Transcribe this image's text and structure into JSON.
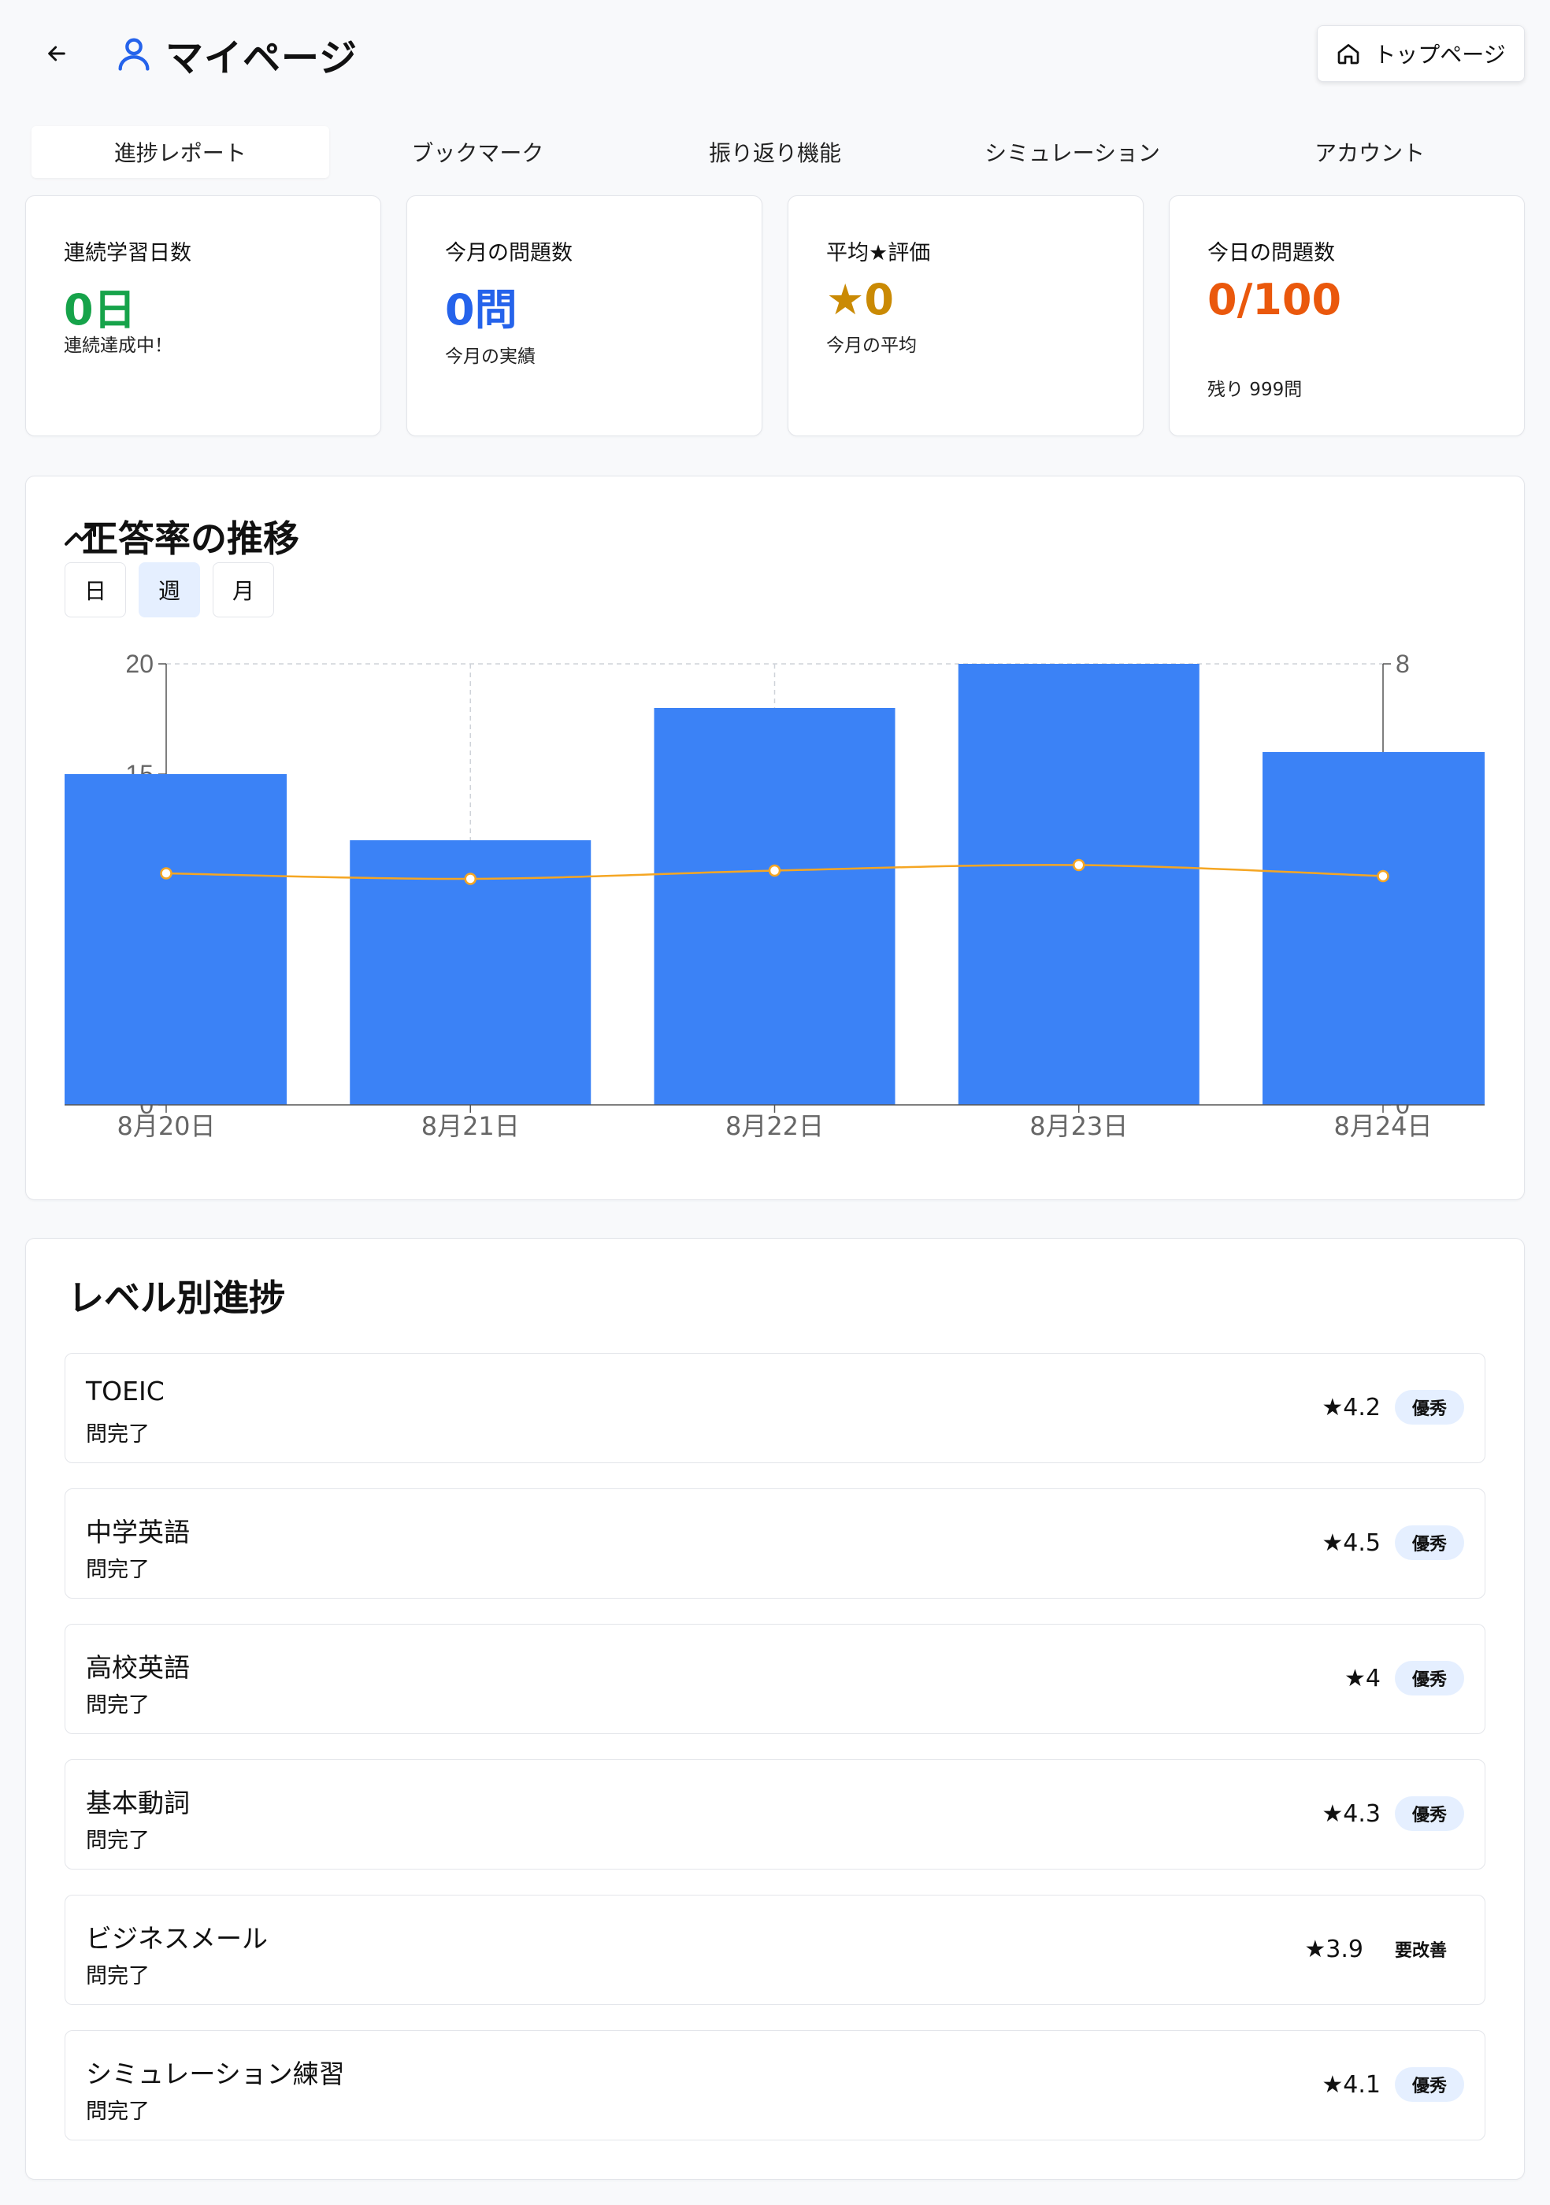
{
  "header": {
    "title": "マイページ",
    "top_button": "トップページ"
  },
  "tabs": [
    {
      "label": "進捗レポート",
      "active": true
    },
    {
      "label": "ブックマーク",
      "active": false
    },
    {
      "label": "振り返り機能",
      "active": false
    },
    {
      "label": "シミュレーション",
      "active": false
    },
    {
      "label": "アカウント",
      "active": false
    }
  ],
  "stats": [
    {
      "label": "連続学習日数",
      "value": "0日",
      "sub": "連続達成中！",
      "color": "#16a34a"
    },
    {
      "label": "今月の問題数",
      "value": "0問",
      "sub": "今月の実績",
      "color": "#2563eb"
    },
    {
      "label": "平均★評価",
      "value": "★0",
      "sub": "今月の平均",
      "color": "#ca8a04"
    },
    {
      "label": "今日の問題数",
      "value": "0/100",
      "sub": "残り 999問",
      "color": "#ea580c"
    }
  ],
  "chart_section": {
    "title": "正答率の推移",
    "periods": [
      {
        "label": "日",
        "active": false
      },
      {
        "label": "週",
        "active": true
      },
      {
        "label": "月",
        "active": false
      }
    ]
  },
  "chart_data": {
    "type": "bar",
    "categories": [
      "8月20日",
      "8月21日",
      "8月22日",
      "8月23日",
      "8月24日"
    ],
    "series": [
      {
        "type": "bar",
        "axis": "left",
        "values": [
          15,
          12,
          18,
          20,
          16
        ],
        "color": "#3b82f6"
      },
      {
        "type": "line",
        "axis": "right",
        "values": [
          4.2,
          4.1,
          4.25,
          4.35,
          4.15
        ],
        "color": "#f5a623"
      }
    ],
    "y_left": {
      "ylim": [
        0,
        20
      ],
      "ticks": [
        "0",
        "15",
        "20"
      ]
    },
    "y_right": {
      "ylim": [
        0,
        8
      ],
      "ticks": [
        "0",
        "8"
      ]
    },
    "grid": true
  },
  "levels_section": {
    "title": "レベル別進捗",
    "items": [
      {
        "name": "TOEIC",
        "status": "問完了",
        "rating": "★4.2",
        "badge": "優秀",
        "badge_type": "good"
      },
      {
        "name": "中学英語",
        "status": "問完了",
        "rating": "★4.5",
        "badge": "優秀",
        "badge_type": "good"
      },
      {
        "name": "高校英語",
        "status": "問完了",
        "rating": "★4",
        "badge": "優秀",
        "badge_type": "good"
      },
      {
        "name": "基本動詞",
        "status": "問完了",
        "rating": "★4.3",
        "badge": "優秀",
        "badge_type": "good"
      },
      {
        "name": "ビジネスメール",
        "status": "問完了",
        "rating": "★3.9",
        "badge": "要改善",
        "badge_type": "needs"
      },
      {
        "name": "シミュレーション練習",
        "status": "問完了",
        "rating": "★4.1",
        "badge": "優秀",
        "badge_type": "good"
      }
    ]
  }
}
